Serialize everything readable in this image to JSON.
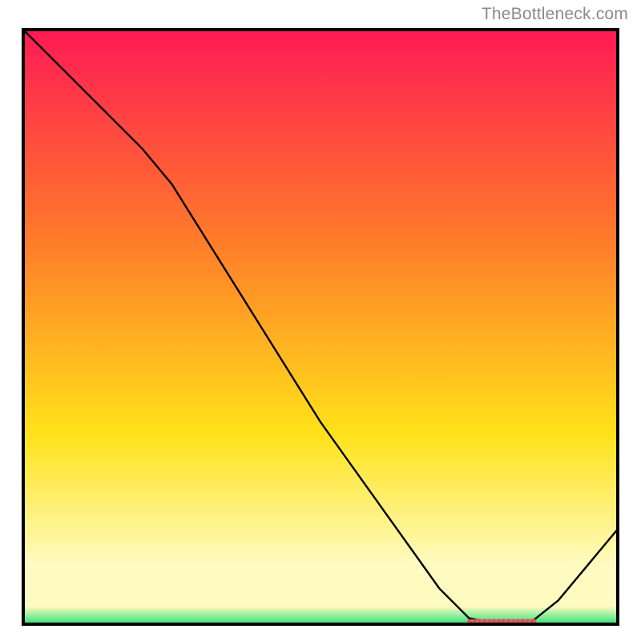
{
  "attribution": "TheBottleneck.com",
  "colors": {
    "gradient_top": "#ff1a55",
    "gradient_mid1": "#ff7a2a",
    "gradient_mid2": "#ffe21a",
    "gradient_low": "#fffbc0",
    "gradient_bottom": "#2ee27a",
    "frame": "#000000",
    "curve": "#000000",
    "marker_fill": "#e06060",
    "marker_stroke": "#c04040"
  },
  "chart_data": {
    "type": "line",
    "title": "",
    "xlabel": "",
    "ylabel": "",
    "xlim": [
      0,
      100
    ],
    "ylim": [
      0,
      100
    ],
    "series": [
      {
        "name": "curve",
        "x": [
          0,
          5,
          10,
          15,
          20,
          25,
          30,
          35,
          40,
          45,
          50,
          55,
          60,
          65,
          70,
          75,
          80,
          85,
          90,
          95,
          100
        ],
        "values": [
          100,
          95,
          90,
          85,
          80,
          74,
          66,
          58,
          50,
          42,
          34,
          27,
          20,
          13,
          6,
          1,
          0,
          0,
          4,
          10,
          16
        ]
      }
    ],
    "marker_band": {
      "x_start": 75,
      "x_end": 86,
      "y": 0.5
    }
  }
}
